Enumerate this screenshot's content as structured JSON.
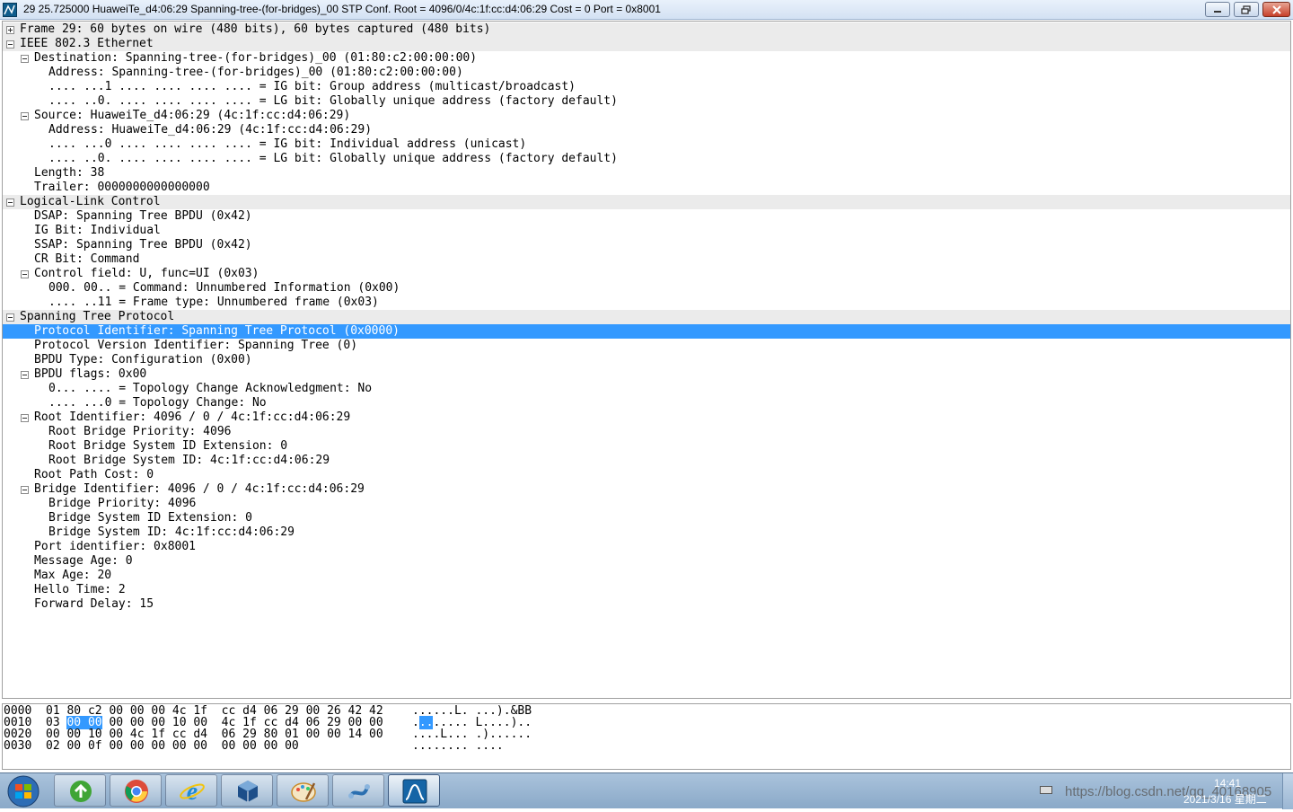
{
  "window": {
    "title": "29 25.725000 HuaweiTe_d4:06:29 Spanning-tree-(for-bridges)_00 STP Conf. Root = 4096/0/4c:1f:cc:d4:06:29  Cost = 0  Port = 0x8001"
  },
  "tree": [
    {
      "level": 0,
      "section": true,
      "expander": "plus",
      "text": "Frame 29: 60 bytes on wire (480 bits), 60 bytes captured (480 bits)"
    },
    {
      "level": 0,
      "section": true,
      "expander": "minus",
      "text": "IEEE 802.3 Ethernet"
    },
    {
      "level": 1,
      "expander": "minus",
      "text": "Destination: Spanning-tree-(for-bridges)_00 (01:80:c2:00:00:00)"
    },
    {
      "level": 2,
      "text": "Address: Spanning-tree-(for-bridges)_00 (01:80:c2:00:00:00)"
    },
    {
      "level": 2,
      "text": ".... ...1 .... .... .... .... = IG bit: Group address (multicast/broadcast)"
    },
    {
      "level": 2,
      "text": ".... ..0. .... .... .... .... = LG bit: Globally unique address (factory default)"
    },
    {
      "level": 1,
      "expander": "minus",
      "text": "Source: HuaweiTe_d4:06:29 (4c:1f:cc:d4:06:29)"
    },
    {
      "level": 2,
      "text": "Address: HuaweiTe_d4:06:29 (4c:1f:cc:d4:06:29)"
    },
    {
      "level": 2,
      "text": ".... ...0 .... .... .... .... = IG bit: Individual address (unicast)"
    },
    {
      "level": 2,
      "text": ".... ..0. .... .... .... .... = LG bit: Globally unique address (factory default)"
    },
    {
      "level": 1,
      "text": "Length: 38"
    },
    {
      "level": 1,
      "text": "Trailer: 0000000000000000"
    },
    {
      "level": 0,
      "section": true,
      "expander": "minus",
      "text": "Logical-Link Control"
    },
    {
      "level": 1,
      "text": "DSAP: Spanning Tree BPDU (0x42)"
    },
    {
      "level": 1,
      "text": "IG Bit: Individual"
    },
    {
      "level": 1,
      "text": "SSAP: Spanning Tree BPDU (0x42)"
    },
    {
      "level": 1,
      "text": "CR Bit: Command"
    },
    {
      "level": 1,
      "expander": "minus",
      "text": "Control field: U, func=UI (0x03)"
    },
    {
      "level": 2,
      "text": "000. 00.. = Command: Unnumbered Information (0x00)"
    },
    {
      "level": 2,
      "text": ".... ..11 = Frame type: Unnumbered frame (0x03)"
    },
    {
      "level": 0,
      "section": true,
      "expander": "minus",
      "text": "Spanning Tree Protocol"
    },
    {
      "level": 1,
      "selected": true,
      "text": "Protocol Identifier: Spanning Tree Protocol (0x0000)"
    },
    {
      "level": 1,
      "text": "Protocol Version Identifier: Spanning Tree (0)"
    },
    {
      "level": 1,
      "text": "BPDU Type: Configuration (0x00)"
    },
    {
      "level": 1,
      "expander": "minus",
      "text": "BPDU flags: 0x00"
    },
    {
      "level": 2,
      "text": "0... .... = Topology Change Acknowledgment: No"
    },
    {
      "level": 2,
      "text": ".... ...0 = Topology Change: No"
    },
    {
      "level": 1,
      "expander": "minus",
      "text": "Root Identifier: 4096 / 0 / 4c:1f:cc:d4:06:29"
    },
    {
      "level": 2,
      "text": "Root Bridge Priority: 4096"
    },
    {
      "level": 2,
      "text": "Root Bridge System ID Extension: 0"
    },
    {
      "level": 2,
      "text": "Root Bridge System ID: 4c:1f:cc:d4:06:29"
    },
    {
      "level": 1,
      "text": "Root Path Cost: 0"
    },
    {
      "level": 1,
      "expander": "minus",
      "text": "Bridge Identifier: 4096 / 0 / 4c:1f:cc:d4:06:29"
    },
    {
      "level": 2,
      "text": "Bridge Priority: 4096"
    },
    {
      "level": 2,
      "text": "Bridge System ID Extension: 0"
    },
    {
      "level": 2,
      "text": "Bridge System ID: 4c:1f:cc:d4:06:29"
    },
    {
      "level": 1,
      "text": "Port identifier: 0x8001"
    },
    {
      "level": 1,
      "text": "Message Age: 0"
    },
    {
      "level": 1,
      "text": "Max Age: 20"
    },
    {
      "level": 1,
      "text": "Hello Time: 2"
    },
    {
      "level": 1,
      "text": "Forward Delay: 15"
    }
  ],
  "hex": [
    {
      "offset": "0000",
      "pre": "01 80 c2 00 00 00 4c 1f  cc d4 06 29 00 26 42 42",
      "hl": "",
      "post": "",
      "apre": "......L. ...).&BB",
      "ahl": "",
      "apost": ""
    },
    {
      "offset": "0010",
      "pre": "03 ",
      "hl": "00 00",
      "post": " 00 00 00 10 00  4c 1f cc d4 06 29 00 00",
      "apre": ".",
      "ahl": "..",
      "apost": "..... L....)..",
      "_note": ""
    },
    {
      "offset": "0020",
      "pre": "00 00 10 00 4c 1f cc d4  06 29 80 01 00 00 14 00",
      "hl": "",
      "post": "",
      "apre": "....L... .)......",
      "ahl": "",
      "apost": ""
    },
    {
      "offset": "0030",
      "pre": "02 00 0f 00 00 00 00 00  00 00 00 00",
      "hl": "",
      "post": "",
      "apre": "........ ....",
      "ahl": "",
      "apost": ""
    }
  ],
  "taskbar": {
    "apps": [
      {
        "name": "chrome-torrent-icon",
        "color": "#3fa535"
      },
      {
        "name": "chrome-icon",
        "color": "#dd4b39"
      },
      {
        "name": "internet-explorer-icon",
        "color": "#1e8bd6"
      },
      {
        "name": "virtualbox-icon",
        "color": "#1d4e89"
      },
      {
        "name": "paint-icon",
        "color": "#c98b2a"
      },
      {
        "name": "network-tool-icon",
        "color": "#2b6fb0"
      },
      {
        "name": "wireshark-icon",
        "color": "#1565a6"
      }
    ],
    "watermark": "https://blog.csdn.net/qq_40168905",
    "time": "14:41",
    "date": "2021/3/16 星期二"
  },
  "colors": {
    "selection": "#3399ff",
    "section_bg": "#ebebeb"
  }
}
